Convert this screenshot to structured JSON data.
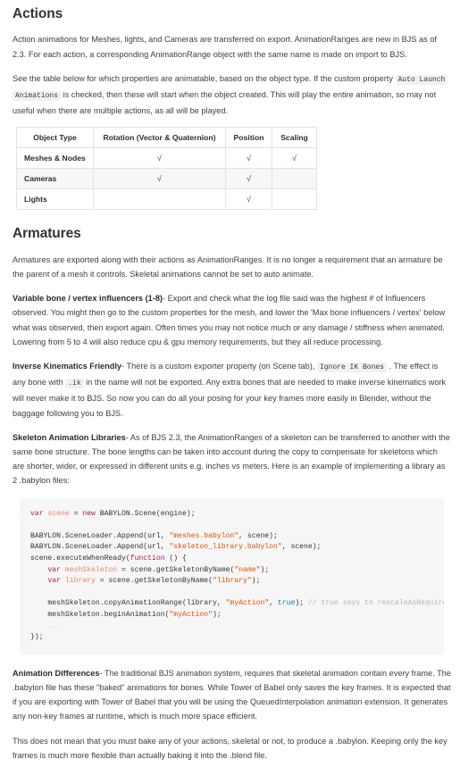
{
  "sections": {
    "actions": {
      "heading": "Actions",
      "para1": "Action animations for Meshes, lights, and Cameras are transferred on export. AnimationRanges are new in BJS as of 2.3. For each action, a corresponding AnimationRange object with the same name is made on import to BJS.",
      "para2_part1": "See the table below for which properties are animatable, based on the object type. If the custom property ",
      "para2_code1": "Auto Launch",
      "para2_code2": "Animations",
      "para2_part2": " is checked, then these will start when the object created. This will play the entire animation, so may not useful when there are multiple actions, as all will be played."
    },
    "armatures": {
      "heading": "Armatures",
      "para1": "Armatures are exported along with their actions as AnimationRanges. It is no longer a requirement that an armature be the parent of a mesh it controls. Skeletal animations cannot be set to auto animate.",
      "variable_bone": {
        "lead": "Variable bone / vertex influencers (1-8)",
        "body": "- Export and check what the log file said was the highest # of Influencers observed. You might then go to the custom properties for the mesh, and lower the 'Max bone influencers / vertex' below what was observed, then export again. Often times you may not notice much or any damage / stiffness when animated. Lowering from 5 to 4 will also reduce cpu & gpu memory requirements, but they all reduce processing."
      },
      "inverse_kinematics": {
        "lead": "Inverse Kinematics Friendly",
        "body_part1": "- There is a custom exporter property (on Scene tab), ",
        "code1": "Ignore IK Bones",
        "body_part2": " . The effect is any bone with ",
        "code2": ".ik",
        "body_part3": " in the name will not be exported. Any extra bones that are needed to make inverse kinematics work will never make it to BJS. So now you can do all your posing for your key frames more easily in Blender, without the baggage following you to BJS."
      },
      "skeleton_libraries": {
        "lead": "Skeleton Animation Libraries",
        "body": "- As of BJS 2.3, the AnimationRanges of a skeleton can be transferred to another with the same bone structure. The bone lengths can be taken into account during the copy to compensate for skeletons which are shorter, wider, or expressed in different units e.g. inches vs meters. Here is an example of implementing a library as 2 .babylon files:"
      },
      "animation_differences": {
        "lead": "Animation Differences",
        "body": "- The traditional BJS animation system, requires that skeletal animation contain every frame. The .babylon file has these \"baked\" animations for bones. While Tower of Babel only saves the key frames. It is expected that if you are exporting with Tower of Babel that you will be using the QueuedInterpolation animation extension. It generates any non-key frames at runtime, which is much more space efficient."
      },
      "closing": "This does not mean that you must bake any of your actions, skeletal or not, to produce a .babylon. Keeping only the key frames is much more flexible than actually baking it into the .blend file."
    }
  },
  "table": {
    "headers": [
      "Object Type",
      "Rotation (Vector & Quaternion)",
      "Position",
      "Scaling"
    ],
    "check_mark": "√",
    "rows": [
      {
        "type": "Meshes & Nodes",
        "rotation": true,
        "position": true,
        "scaling": true
      },
      {
        "type": "Cameras",
        "rotation": true,
        "position": true,
        "scaling": false
      },
      {
        "type": "Lights",
        "rotation": false,
        "position": true,
        "scaling": false
      }
    ]
  },
  "code_block": {
    "language": "javascript",
    "lines": [
      [
        {
          "t": "var",
          "c": "kw"
        },
        {
          "t": " ",
          "c": "plain"
        },
        {
          "t": "scene",
          "c": "var"
        },
        {
          "t": " = ",
          "c": "plain"
        },
        {
          "t": "new",
          "c": "kw"
        },
        {
          "t": " BABYLON.Scene(engine);",
          "c": "plain"
        }
      ],
      [
        {
          "t": "",
          "c": "plain"
        }
      ],
      [
        {
          "t": "BABYLON.SceneLoader.Append(url, ",
          "c": "plain"
        },
        {
          "t": "\"meshes.babylon\"",
          "c": "str"
        },
        {
          "t": ", scene);",
          "c": "plain"
        }
      ],
      [
        {
          "t": "BABYLON.SceneLoader.Append(url, ",
          "c": "plain"
        },
        {
          "t": "\"skeleton_library.babylon\"",
          "c": "str"
        },
        {
          "t": ", scene);",
          "c": "plain"
        }
      ],
      [
        {
          "t": "scene.executeWhenReady(",
          "c": "plain"
        },
        {
          "t": "function",
          "c": "kw"
        },
        {
          "t": " () {",
          "c": "plain"
        }
      ],
      [
        {
          "t": "    ",
          "c": "plain"
        },
        {
          "t": "var",
          "c": "kw"
        },
        {
          "t": " ",
          "c": "plain"
        },
        {
          "t": "meshSkeleton",
          "c": "var"
        },
        {
          "t": " = scene.getSkeletonByName(",
          "c": "plain"
        },
        {
          "t": "\"name\"",
          "c": "str"
        },
        {
          "t": ");",
          "c": "plain"
        }
      ],
      [
        {
          "t": "    ",
          "c": "plain"
        },
        {
          "t": "var",
          "c": "kw"
        },
        {
          "t": " ",
          "c": "plain"
        },
        {
          "t": "library",
          "c": "var"
        },
        {
          "t": " = scene.getSkeletonByName(",
          "c": "plain"
        },
        {
          "t": "\"library\"",
          "c": "str"
        },
        {
          "t": ");",
          "c": "plain"
        }
      ],
      [
        {
          "t": "",
          "c": "plain"
        }
      ],
      [
        {
          "t": "    meshSkeleton.copyAnimationRange(library, ",
          "c": "plain"
        },
        {
          "t": "\"myAction\"",
          "c": "str"
        },
        {
          "t": ", ",
          "c": "plain"
        },
        {
          "t": "true",
          "c": "bool"
        },
        {
          "t": "); ",
          "c": "plain"
        },
        {
          "t": "// true says to rescaleAsRequired",
          "c": "comment"
        }
      ],
      [
        {
          "t": "    meshSkeleton.beginAnimation(",
          "c": "plain"
        },
        {
          "t": "\"myAction\"",
          "c": "str"
        },
        {
          "t": ");",
          "c": "plain"
        }
      ],
      [
        {
          "t": "    ",
          "c": "plain"
        },
        {
          "t": "...",
          "c": "comment"
        }
      ],
      [
        {
          "t": "});",
          "c": "plain"
        }
      ]
    ]
  },
  "colors": {
    "text": "#404040",
    "heading": "#333333",
    "code_background": "#f6f6f6",
    "inline_code_background": "#f1f1f1",
    "table_border": "#e2e2e2",
    "table_stripe": "#f7f7f7",
    "keyword": "#a71d5d",
    "variable": "#e8846b",
    "string": "#df5000",
    "boolean": "#0086b3",
    "comment": "#b6b6b6"
  }
}
